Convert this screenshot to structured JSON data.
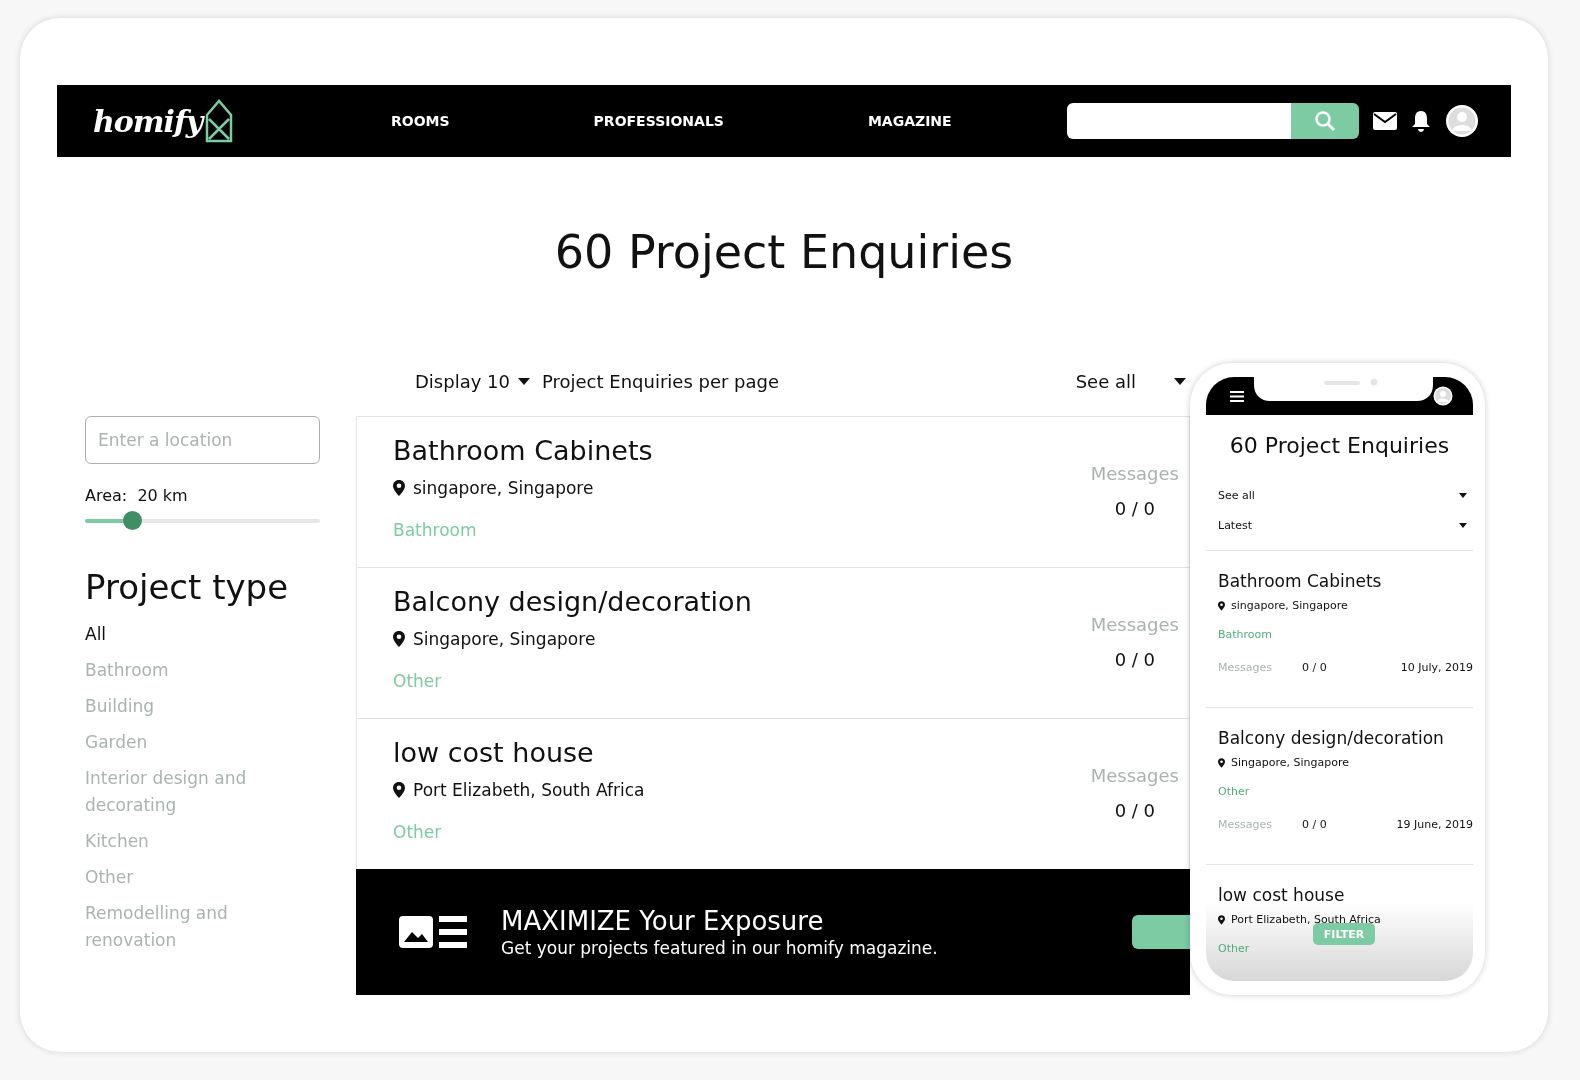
{
  "navbar": {
    "logo": "homify",
    "links": [
      "ROOMS",
      "PROFESSIONALS",
      "MAGAZINE"
    ]
  },
  "heading": "60 Project Enquiries",
  "display": {
    "prefix": "Display 10",
    "suffix": "Project Enquiries per page",
    "filter": "See all"
  },
  "sidebar": {
    "location_placeholder": "Enter a location",
    "area_label": "Area:  20 km",
    "area": {
      "level": 0.2
    },
    "section_title": "Project type",
    "types": [
      {
        "label": "All",
        "selected": true
      },
      {
        "label": "Bathroom",
        "selected": false
      },
      {
        "label": "Building",
        "selected": false
      },
      {
        "label": "Garden",
        "selected": false
      },
      {
        "label": "Interior design and decorating",
        "selected": false
      },
      {
        "label": "Kitchen",
        "selected": false
      },
      {
        "label": "Other",
        "selected": false
      },
      {
        "label": "Remodelling and renovation",
        "selected": false
      }
    ]
  },
  "enquiries": [
    {
      "title": "Bathroom Cabinets",
      "location": "singapore, Singapore",
      "category": "Bathroom",
      "messages_label": "Messages",
      "messages": "0 / 0"
    },
    {
      "title": "Balcony design/decoration",
      "location": "Singapore, Singapore",
      "category": "Other",
      "messages_label": "Messages",
      "messages": "0 / 0"
    },
    {
      "title": "low cost house",
      "location": "Port Elizabeth, South Africa",
      "category": "Other",
      "messages_label": "Messages",
      "messages": "0 / 0"
    }
  ],
  "banner": {
    "title": "MAXIMIZE Your Exposure",
    "text": "Get your projects featured in our homify magazine."
  },
  "phone": {
    "heading": "60 Project Enquiries",
    "dropdowns": [
      "See all",
      "Latest"
    ],
    "enquiries": [
      {
        "title": "Bathroom Cabinets",
        "location": "singapore, Singapore",
        "category": "Bathroom",
        "messages_label": "Messages",
        "messages": "0 / 0",
        "date": "10 July, 2019"
      },
      {
        "title": "Balcony design/decoration",
        "location": "Singapore, Singapore",
        "category": "Other",
        "messages_label": "Messages",
        "messages": "0 / 0",
        "date": "19 June, 2019"
      },
      {
        "title": "low cost house",
        "location": "Port Elizabeth, South Africa",
        "category": "Other"
      }
    ],
    "filter_button": "FILTER"
  }
}
